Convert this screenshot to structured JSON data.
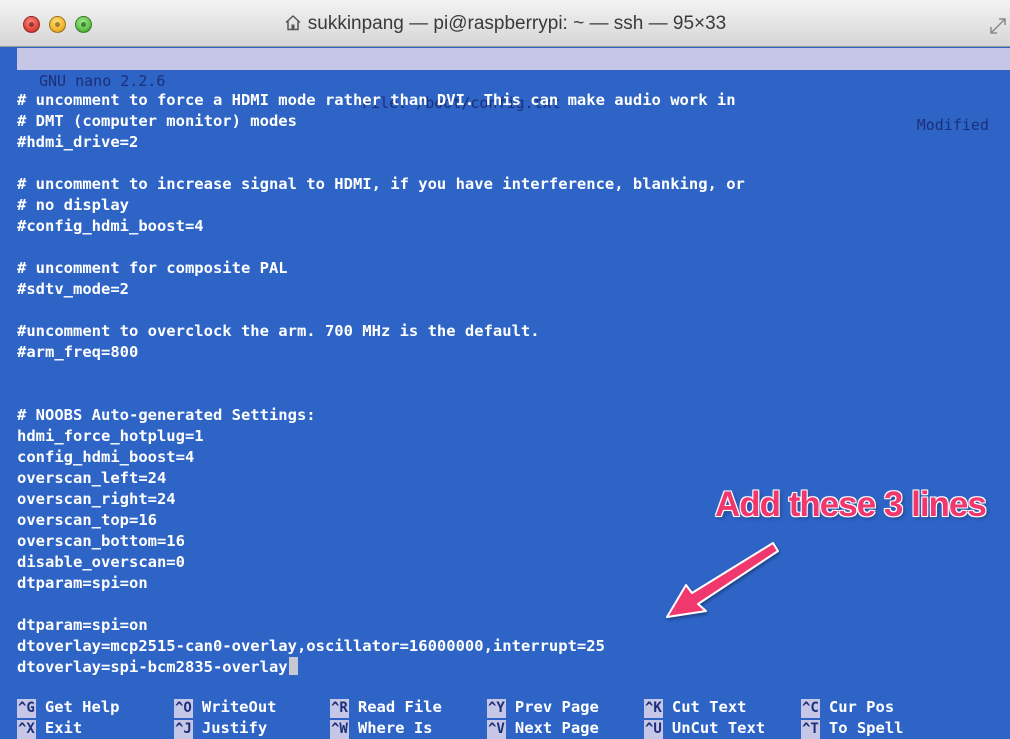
{
  "window": {
    "title": "sukkinpang — pi@raspberrypi: ~ — ssh — 95×33"
  },
  "nano": {
    "version": "GNU nano 2.2.6",
    "filename": "File: /boot/config.txt",
    "status": "Modified"
  },
  "editor": {
    "lines": [
      "# uncomment to force a HDMI mode rather than DVI. This can make audio work in",
      "# DMT (computer monitor) modes",
      "#hdmi_drive=2",
      "",
      "# uncomment to increase signal to HDMI, if you have interference, blanking, or",
      "# no display",
      "#config_hdmi_boost=4",
      "",
      "# uncomment for composite PAL",
      "#sdtv_mode=2",
      "",
      "#uncomment to overclock the arm. 700 MHz is the default.",
      "#arm_freq=800",
      "",
      "",
      "# NOOBS Auto-generated Settings:",
      "hdmi_force_hotplug=1",
      "config_hdmi_boost=4",
      "overscan_left=24",
      "overscan_right=24",
      "overscan_top=16",
      "overscan_bottom=16",
      "disable_overscan=0",
      "dtparam=spi=on",
      "",
      "dtparam=spi=on",
      "dtoverlay=mcp2515-can0-overlay,oscillator=16000000,interrupt=25",
      "dtoverlay=spi-bcm2835-overlay"
    ]
  },
  "annotation": {
    "text": "Add these 3 lines",
    "color": "#f0386e"
  },
  "shortcuts": {
    "row1": [
      {
        "key": "^G",
        "label": "Get Help"
      },
      {
        "key": "^O",
        "label": "WriteOut"
      },
      {
        "key": "^R",
        "label": "Read File"
      },
      {
        "key": "^Y",
        "label": "Prev Page"
      },
      {
        "key": "^K",
        "label": "Cut Text"
      },
      {
        "key": "^C",
        "label": "Cur Pos"
      }
    ],
    "row2": [
      {
        "key": "^X",
        "label": "Exit"
      },
      {
        "key": "^J",
        "label": "Justify"
      },
      {
        "key": "^W",
        "label": "Where Is"
      },
      {
        "key": "^V",
        "label": "Next Page"
      },
      {
        "key": "^U",
        "label": "UnCut Text"
      },
      {
        "key": "^T",
        "label": "To Spell"
      }
    ]
  },
  "colors": {
    "terminal_background": "#2d64c6",
    "nano_bar": "#c6c7e6",
    "text": "#ffffff"
  }
}
